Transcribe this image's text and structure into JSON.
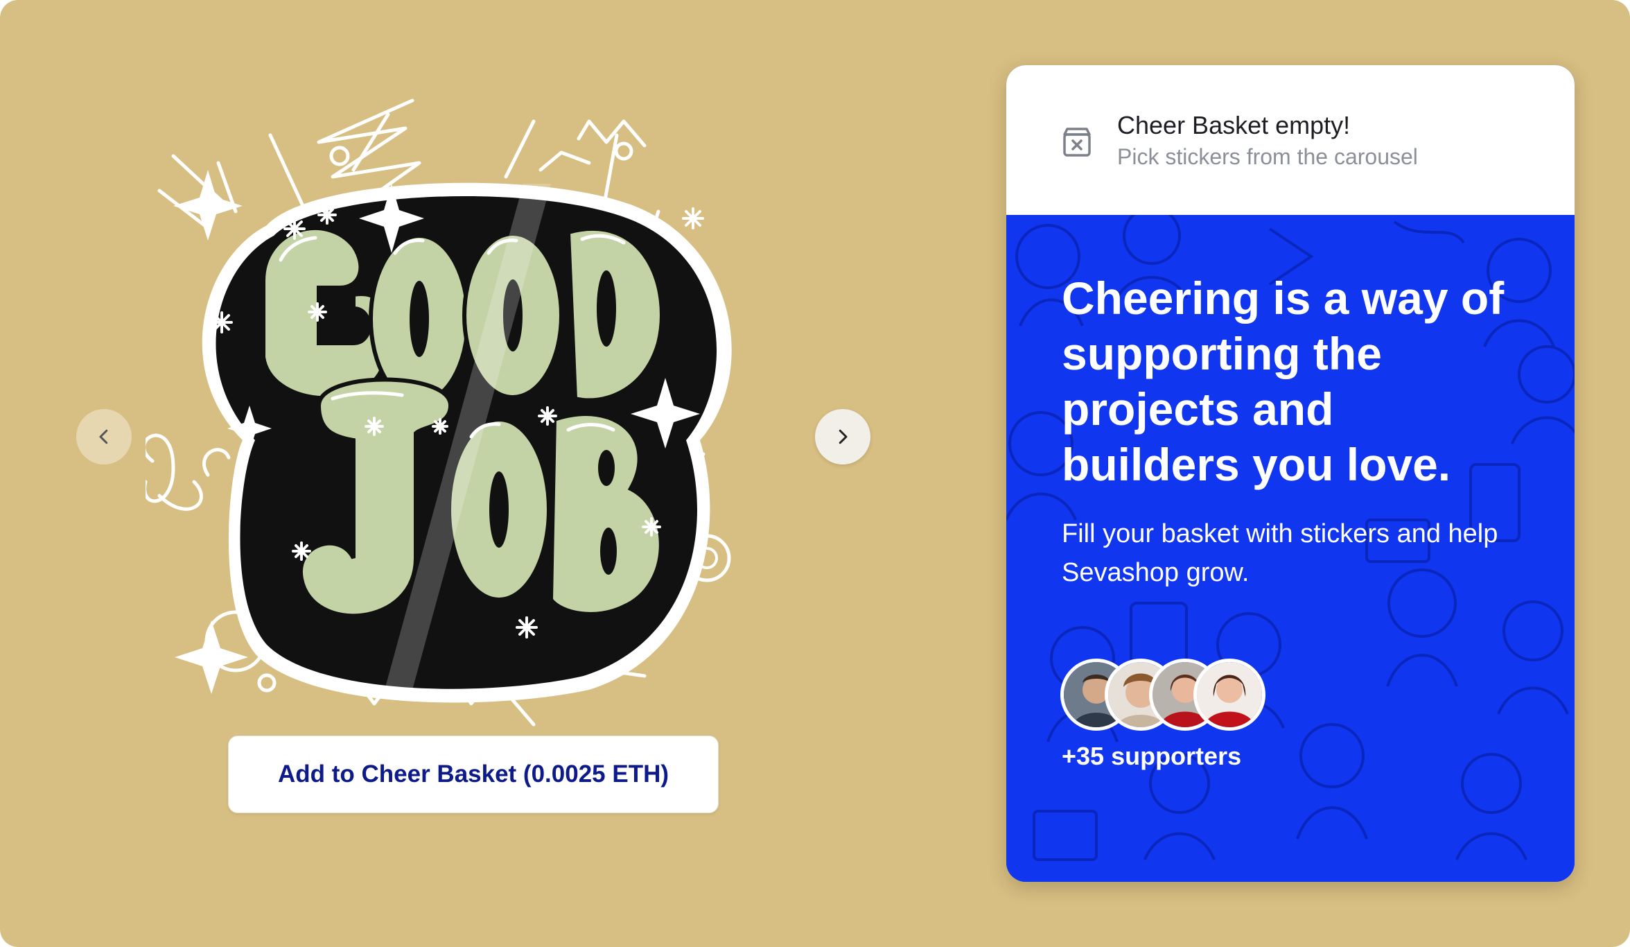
{
  "carousel": {
    "prev_icon": "chevron-left-icon",
    "next_icon": "chevron-right-icon",
    "sticker": "good-job-sticker-illustration",
    "add_button_label": "Add to Cheer Basket (0.0025 ETH)"
  },
  "basket": {
    "icon": "basket-empty-icon",
    "title": "Cheer Basket empty!",
    "subtitle": "Pick stickers from the carousel"
  },
  "promo": {
    "headline": "Cheering is a way of supporting the projects and builders you love.",
    "body": "Fill your basket with stickers and help Sevashop grow.",
    "supporters_label": "+35 supporters",
    "avatars": [
      "supporter-avatar-1",
      "supporter-avatar-2",
      "supporter-avatar-3",
      "supporter-avatar-4"
    ]
  },
  "colors": {
    "background": "#d7be82",
    "promo_blue": "#1136f0",
    "button_text": "#0c1a8a",
    "sticker_green": "#c3d3a6"
  }
}
